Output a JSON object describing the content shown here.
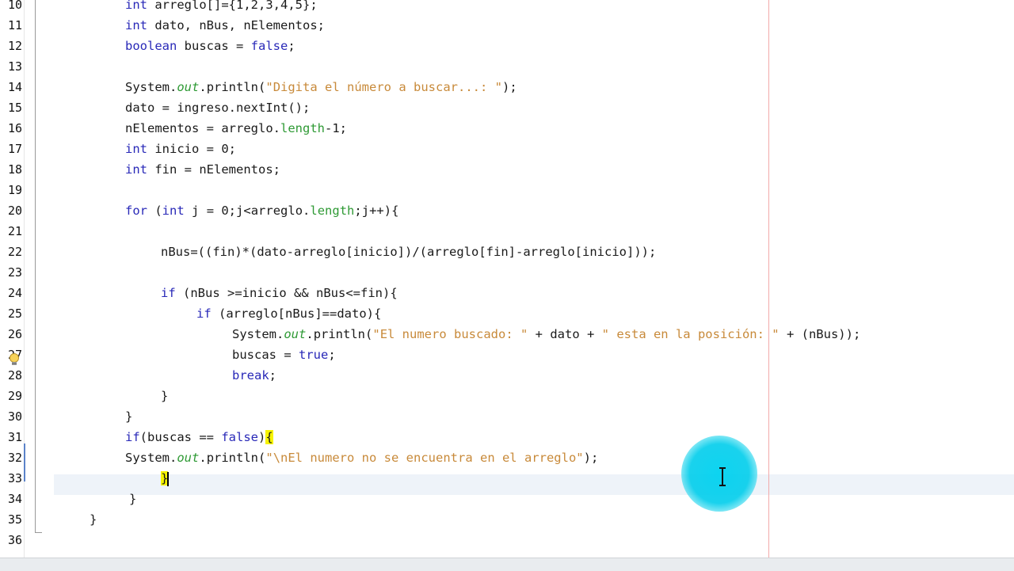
{
  "editor": {
    "colors": {
      "keyword": "#2929b8",
      "string": "#c88a3a",
      "field": "#2f9a35",
      "brace_highlight": "#f6f300",
      "cursor_highlight": "#00d2f0"
    },
    "lines": [
      {
        "n": "10",
        "code": "int arreglo[]={1,2,3,4,5};"
      },
      {
        "n": "11",
        "code": "int dato, nBus, nElementos;"
      },
      {
        "n": "12",
        "code": "boolean buscas = false;"
      },
      {
        "n": "13",
        "code": ""
      },
      {
        "n": "14",
        "code": "System.out.println(\"Digita el número a buscar...: \");"
      },
      {
        "n": "15",
        "code": "dato = ingreso.nextInt();"
      },
      {
        "n": "16",
        "code": "nElementos = arreglo.length-1;"
      },
      {
        "n": "17",
        "code": "int inicio = 0;"
      },
      {
        "n": "18",
        "code": "int fin = nElementos;"
      },
      {
        "n": "19",
        "code": ""
      },
      {
        "n": "20",
        "code": "for (int j = 0;j<arreglo.length;j++){"
      },
      {
        "n": "21",
        "code": ""
      },
      {
        "n": "22",
        "code": "nBus=((fin)*(dato-arreglo[inicio])/(arreglo[fin]-arreglo[inicio]));"
      },
      {
        "n": "23",
        "code": ""
      },
      {
        "n": "24",
        "code": "if (nBus >=inicio && nBus<=fin){"
      },
      {
        "n": "25",
        "code": "if (arreglo[nBus]==dato){"
      },
      {
        "n": "26",
        "code": "System.out.println(\"El numero buscado: \" + dato + \" esta en la posición: \" + (nBus));"
      },
      {
        "n": "27",
        "code": "buscas = true;"
      },
      {
        "n": "28",
        "code": "break;"
      },
      {
        "n": "29",
        "code": "}"
      },
      {
        "n": "30",
        "code": "}"
      },
      {
        "n": "31",
        "code": "if(buscas == false){"
      },
      {
        "n": "32",
        "code": "System.out.println(\"\\nEl numero no se encuentra en el arreglo\");"
      },
      {
        "n": "33",
        "code": "}"
      },
      {
        "n": "34",
        "code": "}"
      },
      {
        "n": "35",
        "code": "}"
      },
      {
        "n": "36",
        "code": ""
      }
    ]
  },
  "icons": {
    "hint": "lightbulb-hint-icon",
    "cursor": "i-beam-cursor-icon",
    "click_highlight": "cursor-highlight-circle"
  }
}
